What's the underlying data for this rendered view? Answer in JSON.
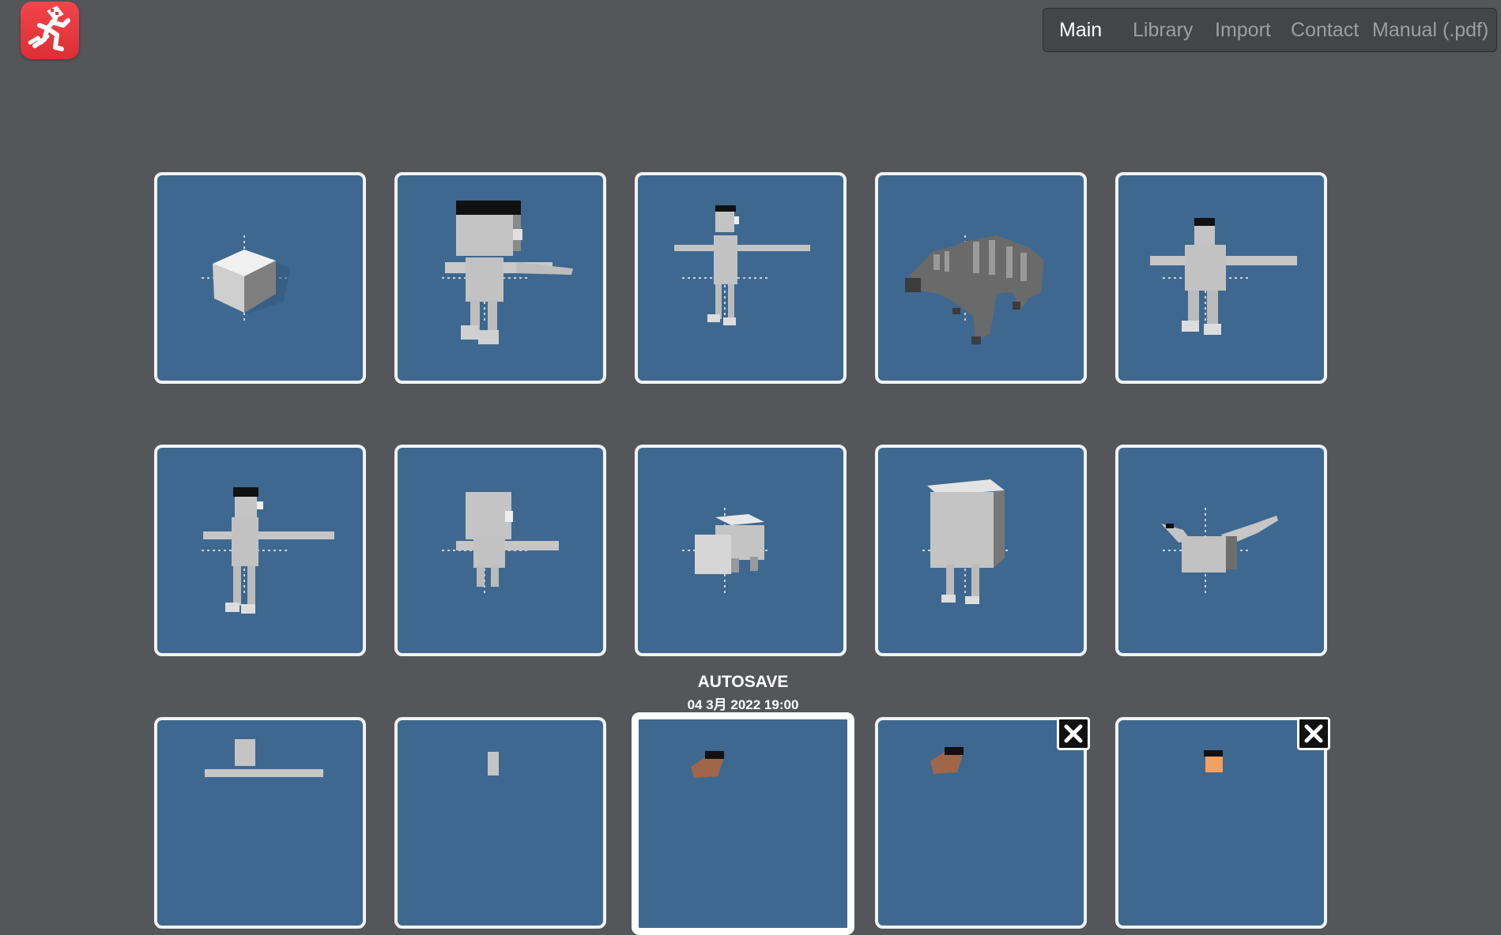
{
  "logo": {
    "icon": "running-figure-icon",
    "color": "#e4363c"
  },
  "nav": {
    "items": [
      {
        "label": "Main",
        "active": true
      },
      {
        "label": "Library",
        "active": false
      },
      {
        "label": "Import",
        "active": false
      },
      {
        "label": "Contact",
        "active": false
      },
      {
        "label": "Manual (.pdf)",
        "active": false
      }
    ]
  },
  "grid": {
    "tile_background": "#3e6890",
    "tile_border": "#f2f2f2",
    "tiles": [
      {
        "model": "cube"
      },
      {
        "model": "boy-character-with-black-hair"
      },
      {
        "model": "slim-humanoid"
      },
      {
        "model": "horse-skeleton"
      },
      {
        "model": "humanoid-with-hat"
      },
      {
        "model": "humanoid-with-black-hair"
      },
      {
        "model": "big-head-character"
      },
      {
        "model": "small-animal"
      },
      {
        "model": "box-body-character"
      },
      {
        "model": "winged-creature"
      },
      {
        "model": "humanoid"
      },
      {
        "model": "thin-figure"
      },
      {
        "model": "brown-character",
        "selected": true
      },
      {
        "model": "brown-character",
        "closable": true
      },
      {
        "model": "orange-character",
        "closable": true
      }
    ]
  },
  "autosave": {
    "title": "AUTOSAVE",
    "date": "04 3月 2022 19:00"
  }
}
